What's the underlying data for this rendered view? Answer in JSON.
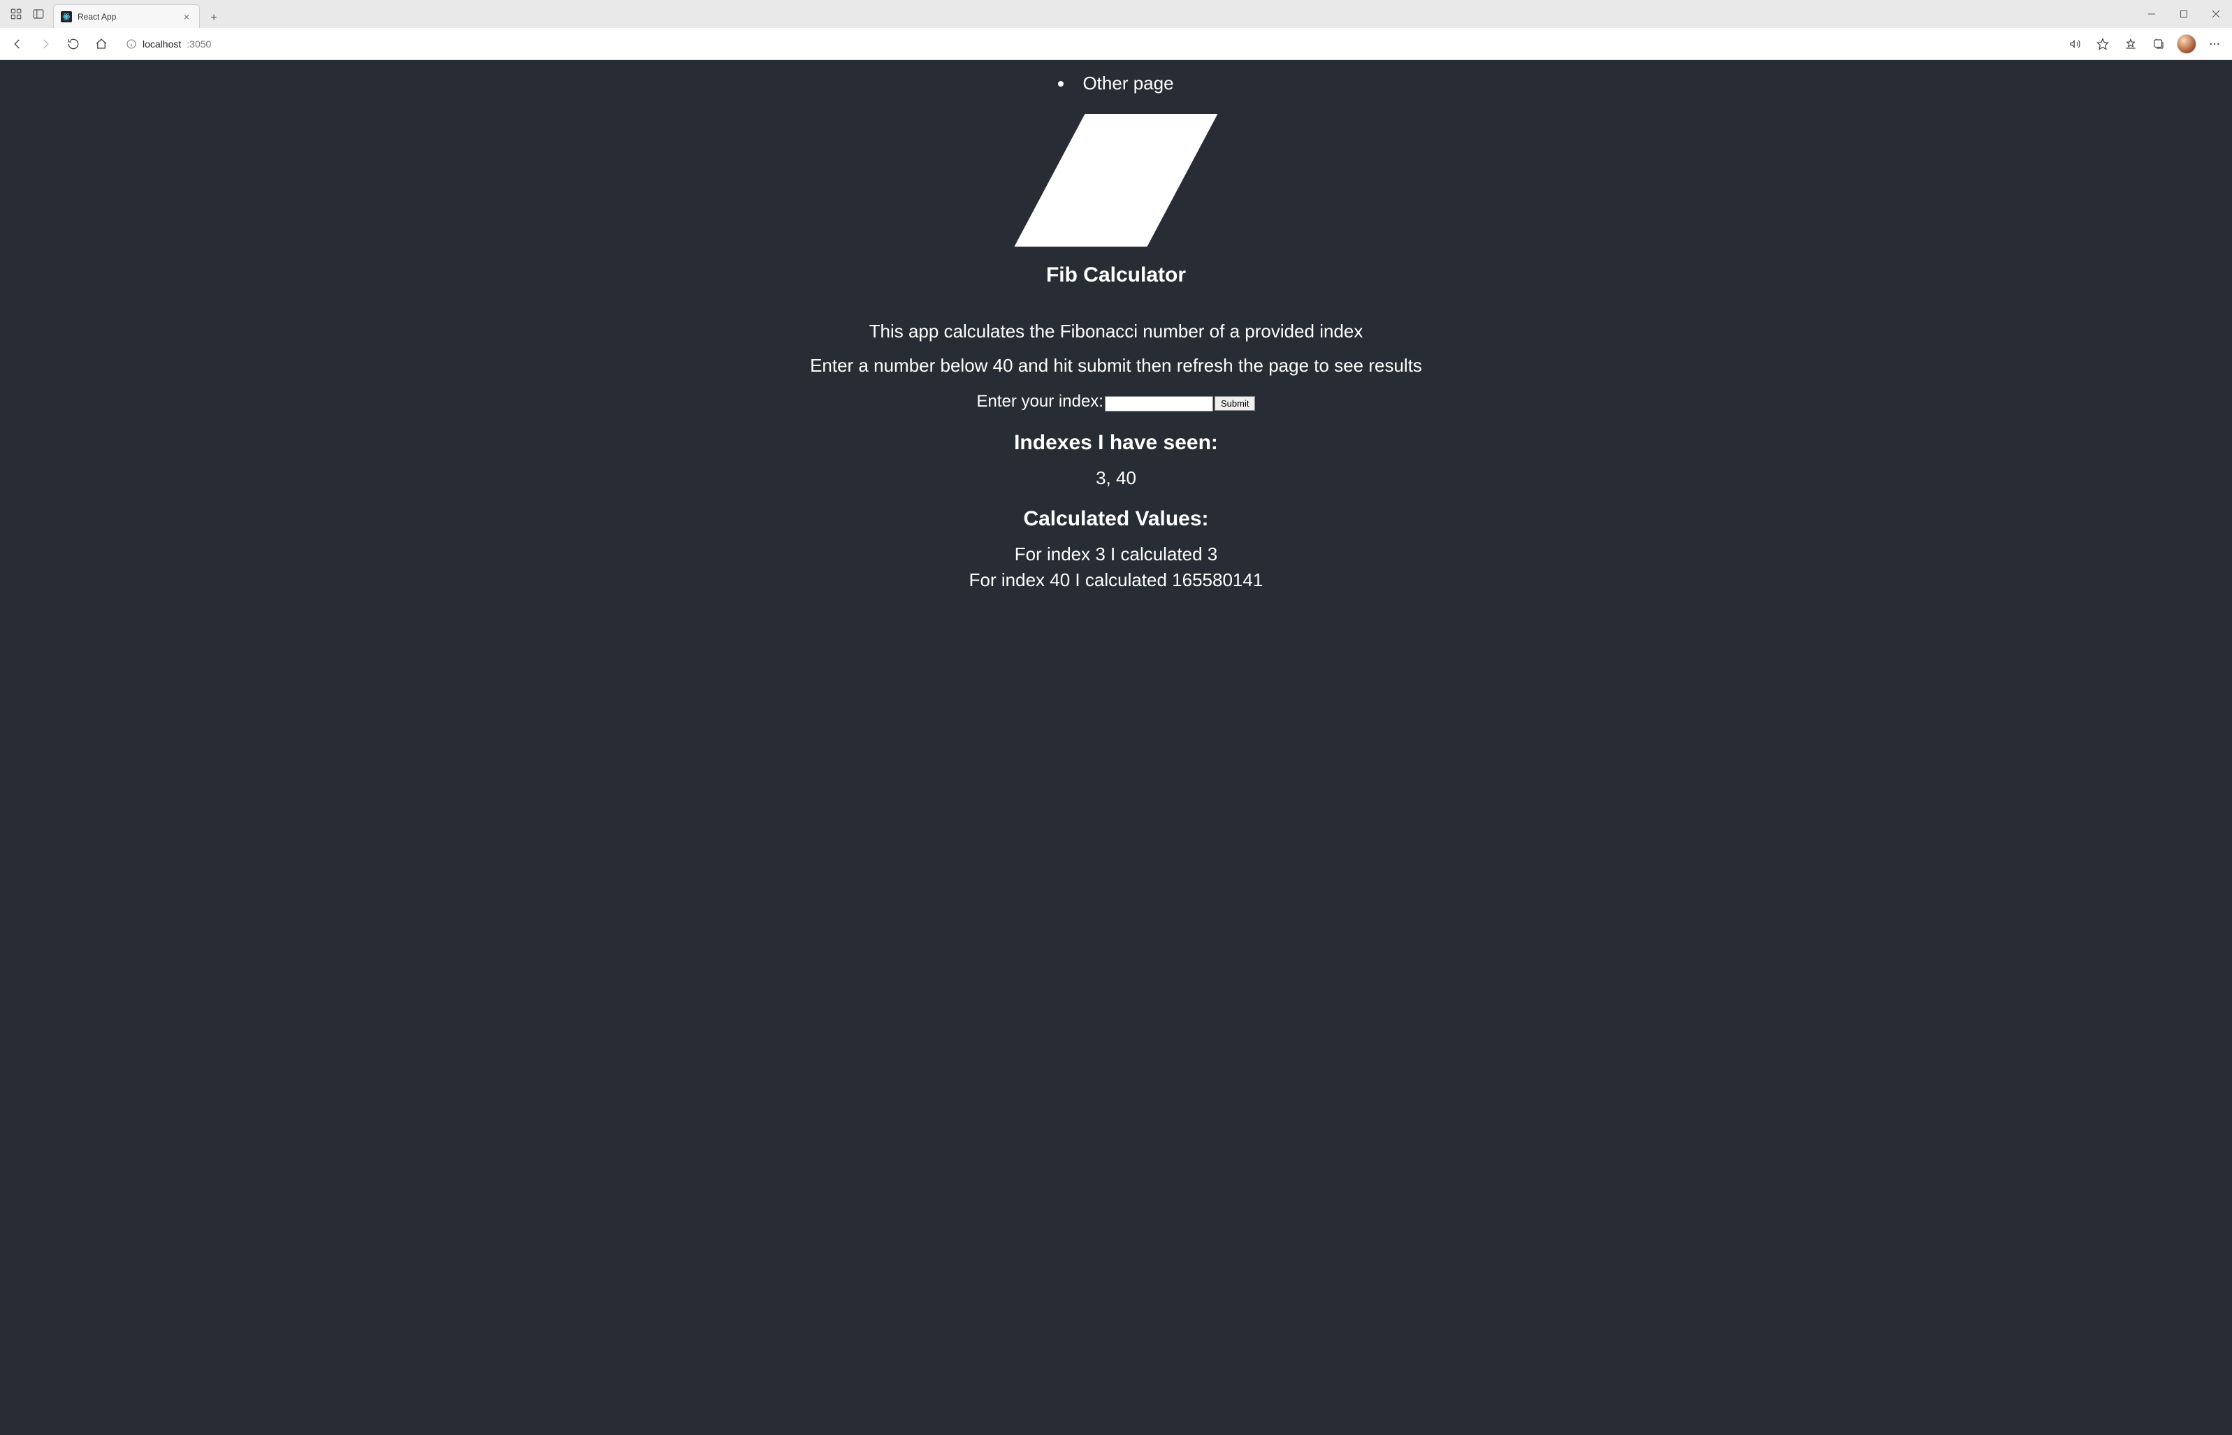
{
  "browser": {
    "tab_title": "React App",
    "url_host": "localhost",
    "url_port": ":3050"
  },
  "nav": {
    "items": [
      {
        "label": "Other page"
      }
    ]
  },
  "page": {
    "title": "Fib Calculator",
    "intro1": "This app calculates the Fibonacci number of a provided index",
    "intro2": "Enter a number below 40 and hit submit then refresh the page to see results",
    "form": {
      "label": "Enter your index:",
      "value": "",
      "submit_label": "Submit"
    },
    "seen": {
      "heading": "Indexes I have seen:",
      "value": "3, 40"
    },
    "calc": {
      "heading": "Calculated Values:",
      "lines": [
        "For index 3 I calculated 3",
        "For index 40 I calculated 165580141"
      ]
    }
  }
}
